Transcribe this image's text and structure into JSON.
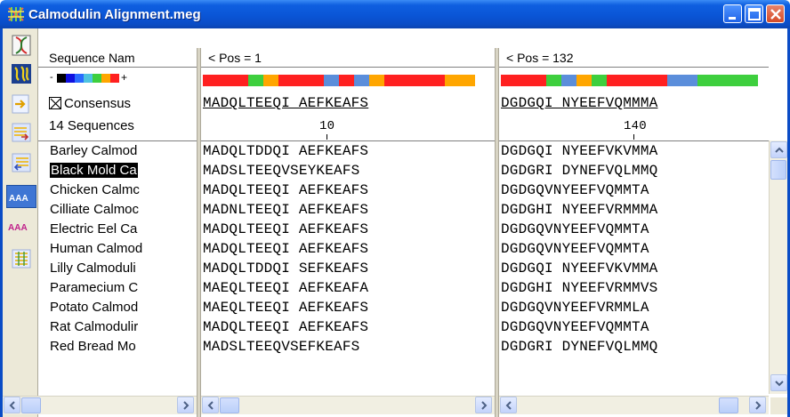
{
  "window": {
    "title": "Calmodulin Alignment.meg",
    "colors": {
      "titlebar": "#0a55d6",
      "close_button": "#d44a27"
    }
  },
  "toolbar": {
    "items": [
      {
        "icon": "dna-helix-icon"
      },
      {
        "icon": "protein-sequence-icon"
      },
      {
        "icon": "move-right-icon"
      },
      {
        "icon": "move-block-right-icon"
      },
      {
        "icon": "move-block-left-icon"
      },
      {
        "icon": "amino-acid-view-icon",
        "label": "AAA"
      },
      {
        "icon": "amino-acid-color-icon",
        "label": "AAA"
      },
      {
        "icon": "grid-view-icon"
      }
    ]
  },
  "names_pane": {
    "header": "Sequence Nam",
    "palette_minus": "-",
    "palette_plus": "+",
    "palette_colors": [
      "#000000",
      "#1010e0",
      "#2a6cff",
      "#4ec3e0",
      "#3ecf3e",
      "#ffa600",
      "#ff2020"
    ],
    "consensus_label": "Consensus",
    "consensus_checked": true,
    "sequence_count": "14 Sequences",
    "selected_index": 1,
    "names": [
      "Barley Calmod",
      "Black Mold Ca",
      "Chicken Calmc",
      "Cilliate Calmoc",
      "Electric Eel Ca",
      "Human Calmod",
      "Lilly Calmoduli",
      "Paramecium C",
      "Potato Calmod",
      "Rat Calmodulir",
      "Red Bread Mo"
    ]
  },
  "middle_pane": {
    "header": "< Pos = 1",
    "consensus": "MADQLTEEQI AEFKEAFS",
    "ruler_label": "10",
    "color_bar": [
      "#ff2020",
      "#ff2020",
      "#ff2020",
      "#3ecf3e",
      "#ffa600",
      "#ff2020",
      "#ff2020",
      "#ff2020",
      "#5b8edb",
      "#ff2020",
      "#5b8edb",
      "#ffa600",
      "#ff2020",
      "#ff2020",
      "#ff2020",
      "#ff2020",
      "#ffa600",
      "#ffa600"
    ],
    "rows": [
      "MADQLTDDQI AEFKEAFS",
      "MADSLTEEQVSEYKEAFS",
      "MADQLTEEQI AEFKEAFS",
      "MADNLTEEQI AEFKEAFS",
      "MADQLTEEQI AEFKEAFS",
      "MADQLTEEQI AEFKEAFS",
      "MADQLTDDQI SEFKEAFS",
      "MAEQLTEEQI AEFKEAFA",
      "MAEQLTEEQI AEFKEAFS",
      "MADQLTEEQI AEFKEAFS",
      "MADSLTEEQVSEFKEAFS"
    ]
  },
  "right_pane": {
    "header": "< Pos = 132",
    "consensus": "DGDGQI NYEEFVQMMMA",
    "ruler_label": "140",
    "color_bar": [
      "#ff2020",
      "#ff2020",
      "#ff2020",
      "#3ecf3e",
      "#5b8edb",
      "#ffa600",
      "#3ecf3e",
      "#ff2020",
      "#ff2020",
      "#ff2020",
      "#ff2020",
      "#5b8edb",
      "#5b8edb",
      "#3ecf3e",
      "#3ecf3e",
      "#3ecf3e",
      "#3ecf3e"
    ],
    "rows": [
      "DGDGQI NYEEFVKVMMA",
      "DGDGRI DYNEFVQLMMQ",
      "DGDGQVNYEEFVQMMTA",
      "DGDGHI NYEEFVRMMMA",
      "DGDGQVNYEEFVQMMTA",
      "DGDGQVNYEEFVQMMTA",
      "DGDGQI NYEEFVKVMMA",
      "DGDGHI NYEEFVRMMVS",
      "DGDGQVNYEEFVRMMLA",
      "DGDGQVNYEEFVQMMTA",
      "DGDGRI DYNEFVQLMMQ"
    ]
  }
}
